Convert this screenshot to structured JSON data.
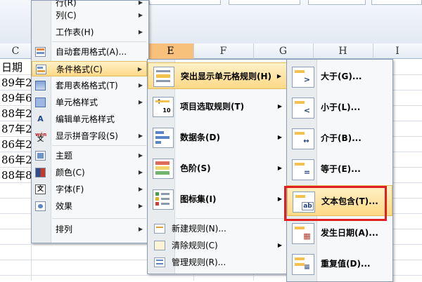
{
  "columns": {
    "c": "C",
    "e": "E",
    "f": "F",
    "g": "G",
    "h": "H",
    "i": "I"
  },
  "cells": [
    "日期",
    "89年2",
    "89年6",
    "88年2",
    "87年2",
    "86年2",
    "86年2",
    "88年8"
  ],
  "context_menu": {
    "items": [
      {
        "label": "行(R)",
        "icon": "row-icon",
        "arrow": "▶"
      },
      {
        "label": "列(C)",
        "icon": "column-icon",
        "arrow": "▶"
      },
      {
        "label": "工作表(H)",
        "icon": "sheet-icon",
        "arrow": "▶"
      },
      {
        "label": "自动套用格式(A)...",
        "icon": "autoformat-icon"
      },
      {
        "label": "条件格式(C)",
        "icon": "conditional-format-icon",
        "arrow": "▶"
      },
      {
        "label": "套用表格格式(T)",
        "icon": "table-format-icon",
        "arrow": "▶"
      },
      {
        "label": "单元格样式",
        "icon": "cell-style-icon",
        "arrow": "▶"
      },
      {
        "label": "编辑单元格样式",
        "icon": "edit-cell-style-icon"
      },
      {
        "label": "显示拼音字段(S)",
        "icon": "phonetic-icon",
        "arrow": "▶"
      },
      {
        "label": "主题",
        "icon": "theme-icon",
        "arrow": "▶"
      },
      {
        "label": "颜色(C)",
        "icon": "color-icon",
        "arrow": "▶"
      },
      {
        "label": "字体(F)",
        "icon": "font-icon",
        "arrow": "▶"
      },
      {
        "label": "效果",
        "icon": "effect-icon",
        "arrow": "▶"
      },
      {
        "label": "排列",
        "icon": "arrange-icon",
        "arrow": "▶"
      }
    ]
  },
  "cf_menu": {
    "items": [
      {
        "label": "突出显示单元格规则(H)",
        "icon": "highlight-rules-icon",
        "arrow": "▶"
      },
      {
        "label": "项目选取规则(T)",
        "icon": "top-bottom-rules-icon",
        "arrow": "▶"
      },
      {
        "label": "数据条(D)",
        "icon": "data-bars-icon",
        "arrow": "▶"
      },
      {
        "label": "色阶(S)",
        "icon": "color-scales-icon",
        "arrow": "▶"
      },
      {
        "label": "图标集(I)",
        "icon": "icon-sets-icon",
        "arrow": "▶"
      },
      {
        "label": "新建规则(N)...",
        "icon": "new-rule-icon"
      },
      {
        "label": "清除规则(C)",
        "icon": "clear-rules-icon",
        "arrow": "▶"
      },
      {
        "label": "管理规则(R)...",
        "icon": "manage-rules-icon"
      }
    ]
  },
  "highlight_menu": {
    "items": [
      {
        "label": "大于(G)...",
        "icon": "greater-than-icon",
        "glyph": ">"
      },
      {
        "label": "小于(L)...",
        "icon": "less-than-icon",
        "glyph": "<"
      },
      {
        "label": "介于(B)...",
        "icon": "between-icon",
        "glyph": "↔"
      },
      {
        "label": "等于(E)...",
        "icon": "equal-to-icon",
        "glyph": "="
      },
      {
        "label": "文本包含(T)...",
        "icon": "text-contains-icon",
        "glyph": "ab"
      },
      {
        "label": "发生日期(A)...",
        "icon": "date-occurring-icon",
        "glyph": "▦"
      },
      {
        "label": "重复值(D)...",
        "icon": "duplicate-values-icon",
        "glyph": "≡"
      }
    ]
  },
  "colors": {
    "highlight_bg": "#fdd986",
    "annotation_red": "#e02020",
    "active_column": "#f8c17b"
  }
}
